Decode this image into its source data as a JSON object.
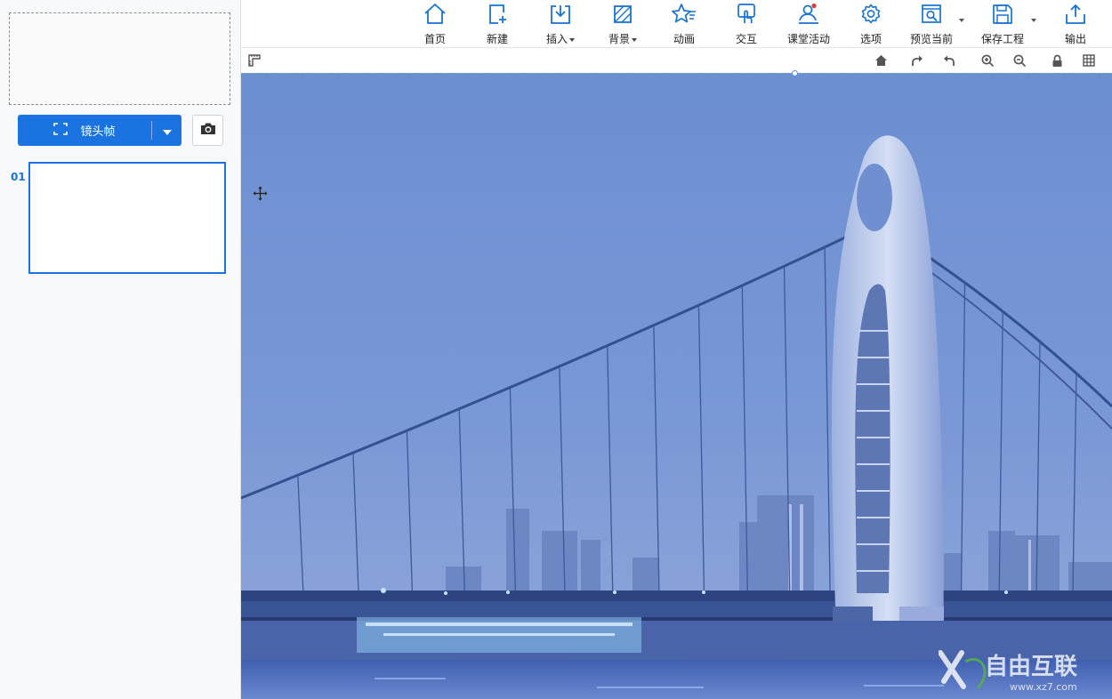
{
  "toolbar": {
    "items": [
      {
        "label": "首页",
        "icon": "home-icon"
      },
      {
        "label": "新建",
        "icon": "new-page-icon"
      },
      {
        "label": "插入",
        "icon": "insert-icon",
        "dropdown": true
      },
      {
        "label": "背景",
        "icon": "background-icon",
        "dropdown": true
      },
      {
        "label": "动画",
        "icon": "animation-icon"
      },
      {
        "label": "交互",
        "icon": "interaction-icon"
      },
      {
        "label": "课堂活动",
        "icon": "classroom-activity-icon"
      },
      {
        "label": "选项",
        "icon": "options-gear-icon"
      },
      {
        "label": "预览当前",
        "icon": "preview-icon",
        "dropdown": true
      },
      {
        "label": "保存工程",
        "icon": "save-icon",
        "dropdown": true
      },
      {
        "label": "输出",
        "icon": "export-icon"
      }
    ]
  },
  "left_panel": {
    "frame_button_label": "镜头帧",
    "slide_number": "01"
  },
  "colors": {
    "accent": "#1a73e0",
    "icon_blue": "#1673d1",
    "sky": "#6f8fd0"
  },
  "watermark": {
    "brand": "自由互联",
    "url": "www.xz7.com"
  }
}
